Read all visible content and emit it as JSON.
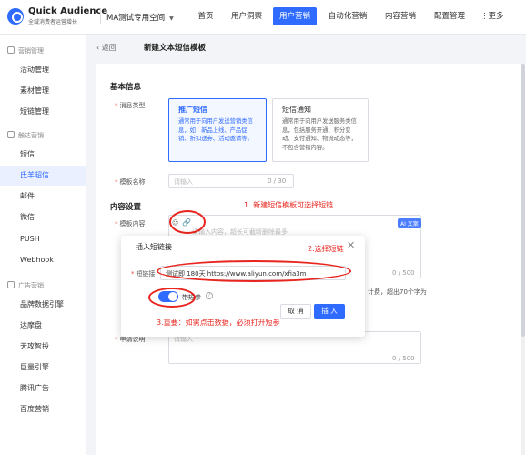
{
  "brand": {
    "title": "Quick Audience",
    "subtitle": "全域消费者运营增长"
  },
  "workspace": {
    "label": "MA测试专用空间",
    "caret": "▼"
  },
  "nav": {
    "items": [
      {
        "label": "首页",
        "active": false
      },
      {
        "label": "用户洞察",
        "active": false
      },
      {
        "label": "用户营销",
        "active": true
      },
      {
        "label": "自动化营销",
        "active": false
      },
      {
        "label": "内容营销",
        "active": false
      },
      {
        "label": "配置管理",
        "active": false
      }
    ],
    "more": "更多"
  },
  "sidebar": {
    "groups": [
      {
        "label": "营销管理",
        "icon": "marketing-icon"
      },
      {
        "label": "触达营销",
        "icon": "reach-icon"
      },
      {
        "label": "广告营销",
        "icon": "ads-icon"
      }
    ],
    "items": [
      {
        "label": "活动管理",
        "active": false
      },
      {
        "label": "素材管理",
        "active": false
      },
      {
        "label": "短链管理",
        "active": false
      },
      {
        "label": "短信",
        "active": false
      },
      {
        "label": "氐羊超信",
        "active": true
      },
      {
        "label": "邮件",
        "active": false
      },
      {
        "label": "微信",
        "active": false
      },
      {
        "label": "PUSH",
        "active": false
      },
      {
        "label": "Webhook",
        "active": false
      },
      {
        "label": "品牌数据引擎",
        "active": false
      },
      {
        "label": "达摩盘",
        "active": false
      },
      {
        "label": "天攻智投",
        "active": false
      },
      {
        "label": "巨量引擎",
        "active": false
      },
      {
        "label": "腾讯广告",
        "active": false
      },
      {
        "label": "百度营销",
        "active": false
      }
    ]
  },
  "header": {
    "back": "返回",
    "title": "新建文本短信模板"
  },
  "basic": {
    "section": "基本信息",
    "type_label": "消息类型",
    "types": [
      {
        "title": "推广短信",
        "desc": "通常用于向用户发送营销类信息，如：新品上线、产品促销、折扣送券、活动邀请等。",
        "selected": true
      },
      {
        "title": "短信通知",
        "desc": "通常用于向用户发送服务类信息，包括服务开通、积分变动、支付通知、物流动态等，不包含营销内容。",
        "selected": false
      }
    ],
    "name_label": "模板名称",
    "name_placeholder": "请输入",
    "name_counter": "0 / 30"
  },
  "content": {
    "section": "内容设置",
    "content_label": "模板内容",
    "content_placeholder": "请输入内容，超长可截断删除最多",
    "ai_badge": "AI 文案",
    "content_counter": "0 / 500",
    "fee_note": "计费，超出70个字为",
    "remark_label": "申请说明",
    "remark_placeholder": "请输入",
    "remark_counter": "0 / 500"
  },
  "annotations": {
    "step1": "1. 新建短信模板可选择短链",
    "step2": "2.选择短链",
    "step3": "3.重要：如需点击数据，必须打开短参"
  },
  "modal": {
    "title": "插入短链接",
    "close": "✕",
    "link_label": "短链接",
    "link_value": "测试即  180天  https://www.aliyun.com/xfia3m",
    "param_label": "带短参",
    "cancel": "取 消",
    "confirm": "插 入"
  },
  "colors": {
    "accent": "#2f6bff",
    "annotation": "#e8251e"
  }
}
